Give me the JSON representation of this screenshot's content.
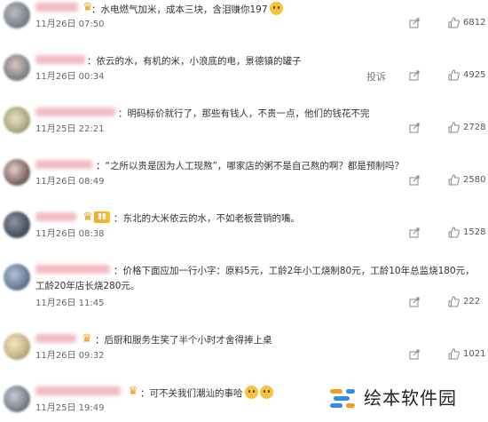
{
  "comments": [
    {
      "text_a": "：水电燃气加米，成本三块，含泪赚你197",
      "text_b": "",
      "time": "11月26日 07:50",
      "likes": "6812",
      "username_width": 48,
      "has_report": false,
      "has_emoji": true
    },
    {
      "text_a": "：依云的水，有机的米，小浪底的电，景德镇的罐子",
      "text_b": "",
      "time": "11月26日 00:34",
      "likes": "4925",
      "has_report": true
    },
    {
      "text_a": "：明码标价就行了，那些有钱人，不贵一点，他们的钱花不完",
      "text_b": "",
      "time": "11月25日 22:21",
      "likes": "2728"
    },
    {
      "text_a": "：“之所以贵是因为人工现熬”，哪家店的粥不是自己熬的啊？都是预制吗？",
      "text_b": "",
      "time": "11月26日 08:49",
      "likes": "2580"
    },
    {
      "text_a": "：东北的大米依云的水，不如老板营销的嘴。",
      "text_b": "",
      "time": "11月26日 08:38",
      "likes": "1528"
    },
    {
      "text_a": "：价格下面应加一行小字：原料5元，工龄2年小工烧制80元，工龄10年总监烧180元，",
      "text_b": "工龄20年店长烧280元。",
      "time": "11月26日 11:45",
      "likes": "222"
    },
    {
      "text_a": "：后厨和服务生笑了半个小时才舍得捧上桌",
      "text_b": "",
      "time": "11月26日 09:32",
      "likes": "1021"
    },
    {
      "text_a": "：可不关我们潮汕的事哈",
      "text_b": "",
      "time": "11月25日 19:49",
      "likes": ""
    }
  ],
  "report_label": "投诉",
  "watermark_text": "绘本软件园",
  "icons": {
    "share": "share-icon",
    "like": "like-icon",
    "crown": "crown-icon",
    "emoji": "emoji-icon"
  },
  "colors": {
    "username_blur": "#f2bcc2",
    "text": "#333333",
    "time": "#666666",
    "badge": "#f6a623"
  }
}
